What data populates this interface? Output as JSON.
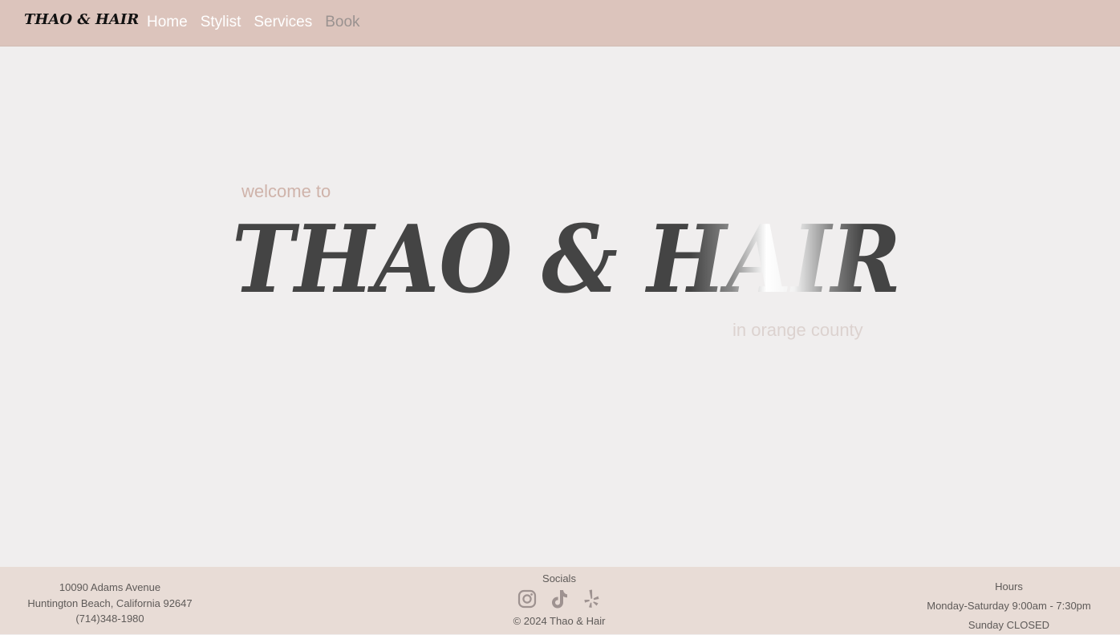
{
  "nav": {
    "brand": "THAO & HAIR",
    "links": [
      {
        "label": "Home"
      },
      {
        "label": "Stylist"
      },
      {
        "label": "Services"
      },
      {
        "label": "Book"
      }
    ]
  },
  "hero": {
    "welcome": "welcome to",
    "title": "THAO & HAIR",
    "subtitle": "in orange county"
  },
  "footer": {
    "address_line1": "10090 Adams Avenue",
    "address_line2": "Huntington Beach, California 92647",
    "phone": "(714)348-1980",
    "socials_title": "Socials",
    "social_icons": [
      "instagram-icon",
      "tiktok-icon",
      "yelp-icon"
    ],
    "copyright": "© 2024 Thao & Hair",
    "hours_title": "Hours",
    "hours_weekday": "Monday-Saturday 9:00am - 7:30pm",
    "hours_sunday": "Sunday CLOSED"
  },
  "colors": {
    "navbar_bg": "#dcc4bc",
    "page_bg": "#f0eeee",
    "footer_bg": "#e8dcd6",
    "title_text": "#444444",
    "welcome_text": "#cfb3aa",
    "icon": "#9e9290"
  }
}
